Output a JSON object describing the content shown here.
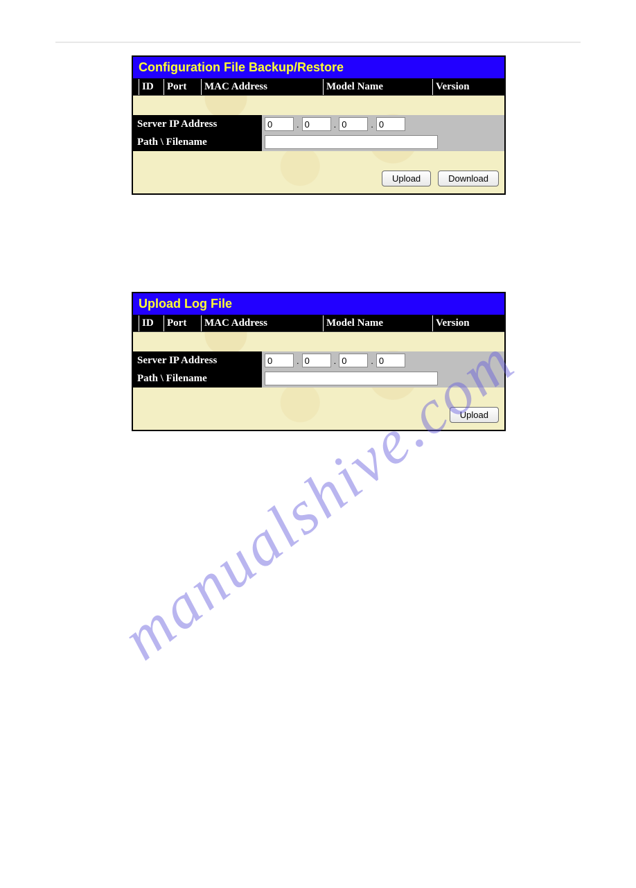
{
  "watermark": "manualshive.com",
  "panels": {
    "config": {
      "title": "Configuration File Backup/Restore",
      "headers": {
        "id": "ID",
        "port": "Port",
        "mac": "MAC Address",
        "model": "Model Name",
        "version": "Version"
      },
      "form": {
        "server_ip_label": "Server IP Address",
        "ip_octets": [
          "0",
          "0",
          "0",
          "0"
        ],
        "path_label": "Path \\ Filename",
        "path_value": ""
      },
      "buttons": {
        "upload": "Upload",
        "download": "Download"
      }
    },
    "log": {
      "title": "Upload Log File",
      "headers": {
        "id": "ID",
        "port": "Port",
        "mac": "MAC Address",
        "model": "Model Name",
        "version": "Version"
      },
      "form": {
        "server_ip_label": "Server IP Address",
        "ip_octets": [
          "0",
          "0",
          "0",
          "0"
        ],
        "path_label": "Path \\ Filename",
        "path_value": ""
      },
      "buttons": {
        "upload": "Upload"
      }
    }
  }
}
